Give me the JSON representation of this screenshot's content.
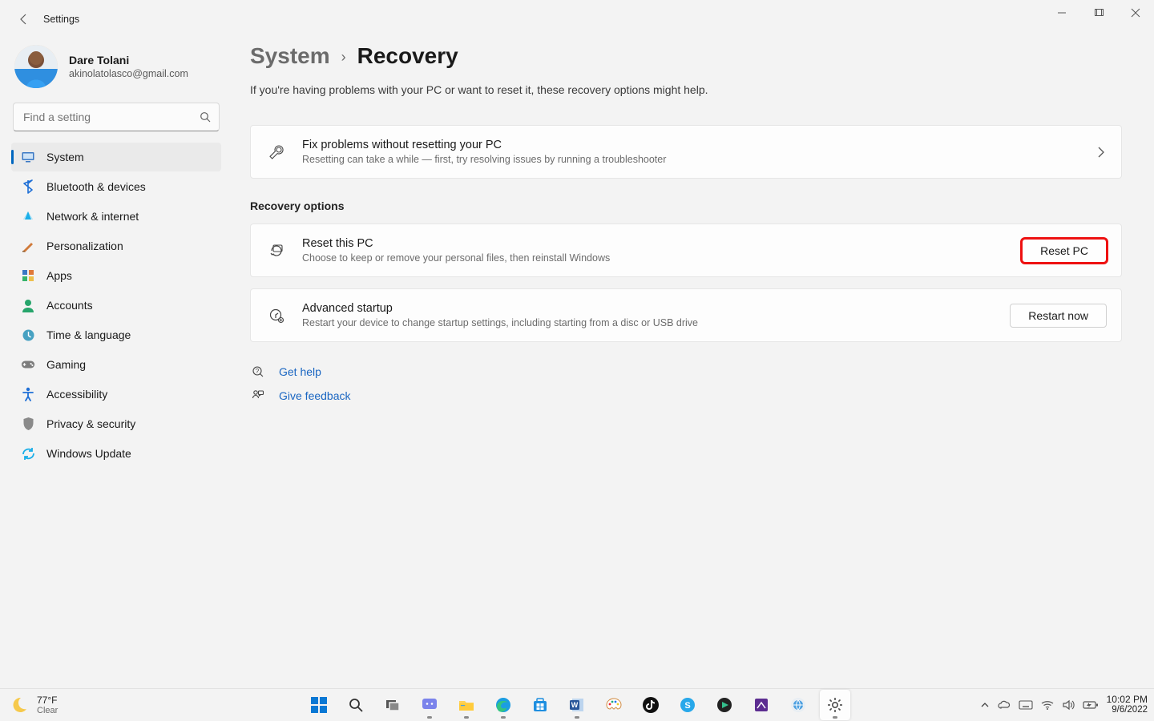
{
  "window": {
    "title": "Settings"
  },
  "user": {
    "name": "Dare Tolani",
    "email": "akinolatolasco@gmail.com"
  },
  "search": {
    "placeholder": "Find a setting"
  },
  "sidebar": {
    "items": [
      {
        "label": "System",
        "icon": "system",
        "color": "#3a78c4",
        "active": true
      },
      {
        "label": "Bluetooth & devices",
        "icon": "bluetooth",
        "color": "#1e6fd6"
      },
      {
        "label": "Network & internet",
        "icon": "network",
        "color": "#1aaee8"
      },
      {
        "label": "Personalization",
        "icon": "personalization",
        "color": "#d07a3a"
      },
      {
        "label": "Apps",
        "icon": "apps",
        "color": "#3a78c4"
      },
      {
        "label": "Accounts",
        "icon": "accounts",
        "color": "#27a56b"
      },
      {
        "label": "Time & language",
        "icon": "time",
        "color": "#47a1c2"
      },
      {
        "label": "Gaming",
        "icon": "gaming",
        "color": "#7c7c7c"
      },
      {
        "label": "Accessibility",
        "icon": "accessibility",
        "color": "#1e6fd6"
      },
      {
        "label": "Privacy & security",
        "icon": "privacy",
        "color": "#8a8a8a"
      },
      {
        "label": "Windows Update",
        "icon": "update",
        "color": "#1aaee8"
      }
    ]
  },
  "breadcrumb": {
    "root": "System",
    "current": "Recovery"
  },
  "lead": "If you're having problems with your PC or want to reset it, these recovery options might help.",
  "card_fix": {
    "title": "Fix problems without resetting your PC",
    "sub": "Resetting can take a while — first, try resolving issues by running a troubleshooter"
  },
  "section": "Recovery options",
  "card_reset": {
    "title": "Reset this PC",
    "sub": "Choose to keep or remove your personal files, then reinstall Windows",
    "button": "Reset PC"
  },
  "card_advanced": {
    "title": "Advanced startup",
    "sub": "Restart your device to change startup settings, including starting from a disc or USB drive",
    "button": "Restart now"
  },
  "links": {
    "help": "Get help",
    "feedback": "Give feedback"
  },
  "taskbar": {
    "weather": {
      "temp": "77°F",
      "cond": "Clear"
    },
    "time": "10:02 PM",
    "date": "9/6/2022"
  }
}
